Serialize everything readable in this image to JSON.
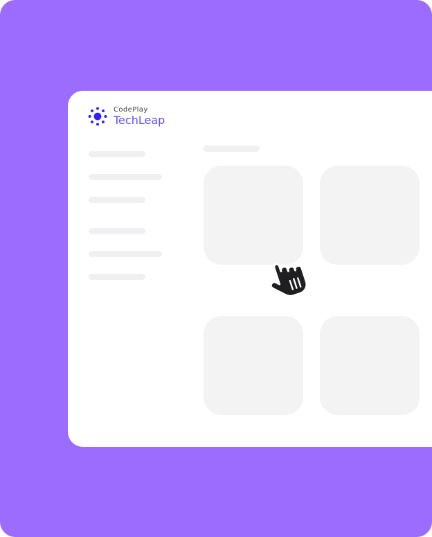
{
  "brand": {
    "sub_label": "CodePlay",
    "main_label": "TechLeap",
    "accent_color": "#5b4dff",
    "logo_icon": "sun-dots-icon"
  },
  "background": {
    "color": "#9b6cff"
  },
  "sidebar": {
    "placeholder_items": [
      "nav-placeholder-1",
      "nav-placeholder-2",
      "nav-placeholder-3",
      "nav-placeholder-4",
      "nav-placeholder-5",
      "nav-placeholder-6"
    ]
  },
  "content": {
    "placeholder_cards": 4
  },
  "cursor": {
    "icon": "hand-cursor-icon"
  }
}
